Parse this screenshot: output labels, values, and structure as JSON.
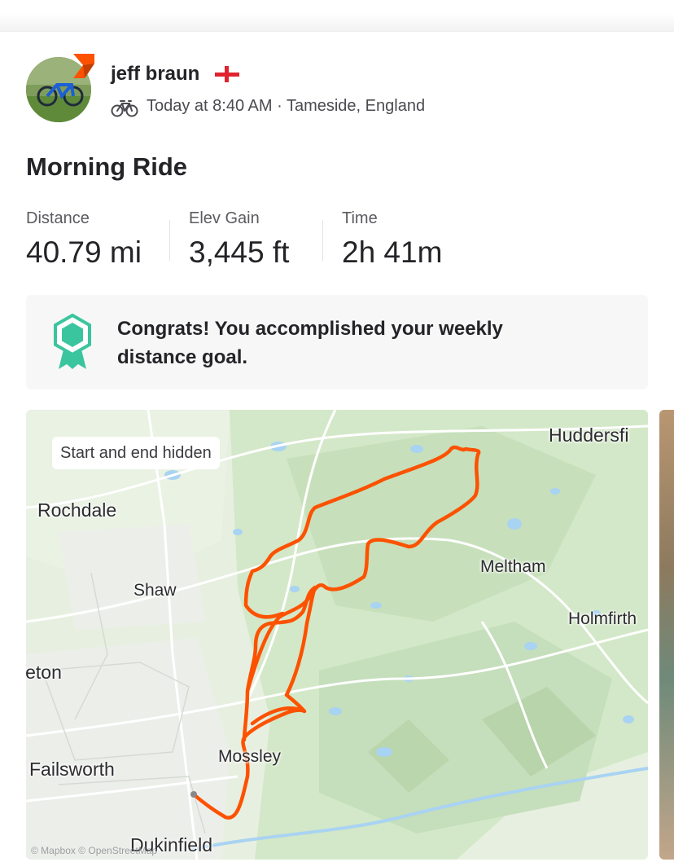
{
  "athlete": {
    "name": "jeff braun",
    "flag_icon": "england-flag-icon"
  },
  "activity": {
    "type_icon": "bicycle-icon",
    "meta": "Today at 8:40 AM · Tameside, England",
    "title": "Morning Ride"
  },
  "stats": [
    {
      "label": "Distance",
      "value": "40.79 mi"
    },
    {
      "label": "Elev Gain",
      "value": "3,445 ft"
    },
    {
      "label": "Time",
      "value": "2h 41m"
    }
  ],
  "goal": {
    "icon": "award-ribbon-icon",
    "line1": "Congrats! You accomplished your weekly",
    "line2": "distance goal."
  },
  "map": {
    "privacy_pill": "Start and end hidden",
    "labels": [
      "Huddersfi",
      "Rochdale",
      "Meltham",
      "Shaw",
      "Holmfirth",
      "leton",
      "Mossley",
      "Failsworth",
      "Dukinfield"
    ],
    "attribution": "© Mapbox © OpenStreetMap",
    "route_color": "#fc5200"
  },
  "colors": {
    "brand_orange": "#fc5200",
    "goal_green": "#3bc59e"
  }
}
